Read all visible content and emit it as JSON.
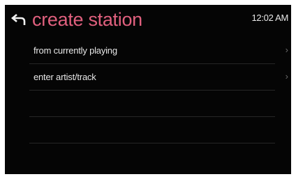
{
  "header": {
    "back_icon": "back-arrow-icon",
    "title": "create station",
    "time": "12:02 AM"
  },
  "menu": {
    "items": [
      {
        "label": "from currently playing",
        "icon": "chevron-right-icon"
      },
      {
        "label": "enter artist/track",
        "icon": "chevron-right-icon"
      }
    ],
    "chevron": "›"
  },
  "colors": {
    "title": "#e0607e",
    "background": "#050505",
    "text": "#e6e6e6",
    "divider": "#262626"
  }
}
